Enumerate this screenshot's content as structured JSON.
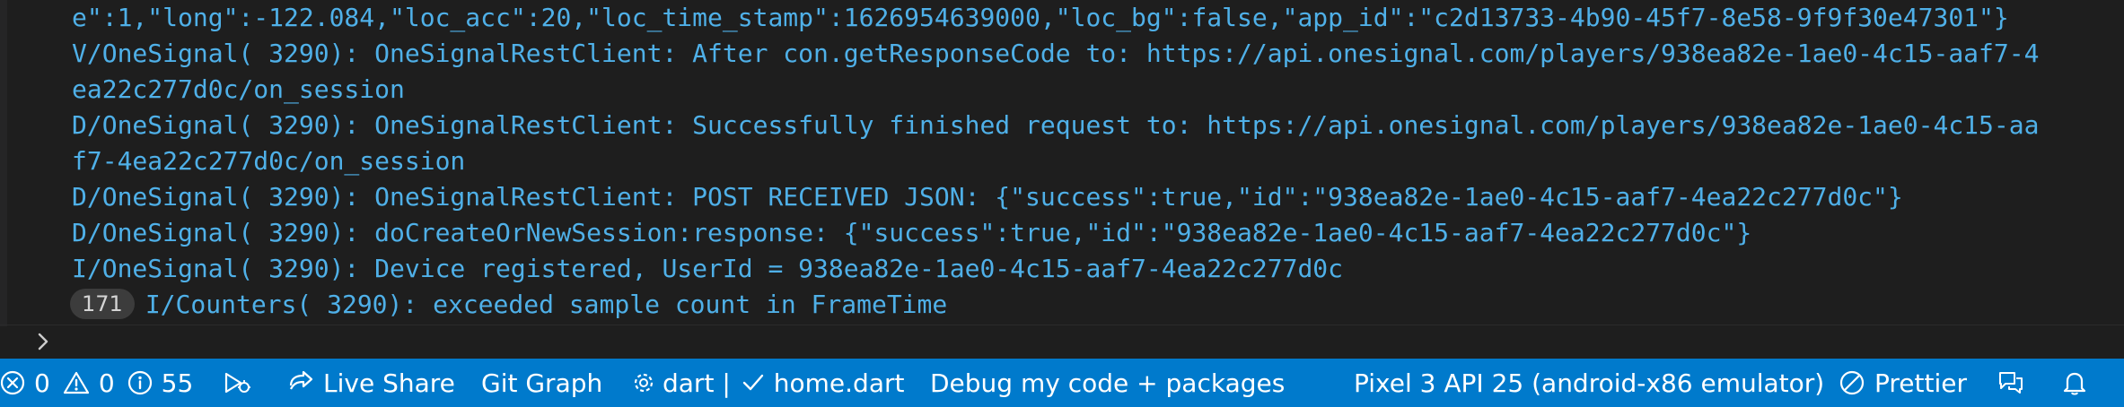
{
  "console": {
    "lines": [
      {
        "text": "e\":1,\"long\":-122.084,\"loc_acc\":20,\"loc_time_stamp\":1626954639000,\"loc_bg\":false,\"app_id\":\"c2d13733-4b90-45f7-8e58-9f9f30e47301\"}"
      },
      {
        "text": "V/OneSignal( 3290): OneSignalRestClient: After con.getResponseCode to: https://api.onesignal.com/players/938ea82e-1ae0-4c15-aaf7-4"
      },
      {
        "text": "ea22c277d0c/on_session"
      },
      {
        "text": "D/OneSignal( 3290): OneSignalRestClient: Successfully finished request to: https://api.onesignal.com/players/938ea82e-1ae0-4c15-aa"
      },
      {
        "text": "f7-4ea22c277d0c/on_session"
      },
      {
        "text": "D/OneSignal( 3290): OneSignalRestClient: POST RECEIVED JSON: {\"success\":true,\"id\":\"938ea82e-1ae0-4c15-aaf7-4ea22c277d0c\"}"
      },
      {
        "text": "D/OneSignal( 3290): doCreateOrNewSession:response: {\"success\":true,\"id\":\"938ea82e-1ae0-4c15-aaf7-4ea22c277d0c\"}"
      },
      {
        "text": "I/OneSignal( 3290): Device registered, UserId = 938ea82e-1ae0-4c15-aaf7-4ea22c277d0c"
      },
      {
        "text": "I/Counters( 3290): exceeded sample count in FrameTime",
        "count": "171"
      }
    ]
  },
  "statusbar": {
    "errors": "0",
    "warnings": "0",
    "infos": "55",
    "live_share": "Live Share",
    "git_graph": "Git Graph",
    "dart": "dart |",
    "dart_file": "home.dart",
    "debug_mode": "Debug my code + packages",
    "device": "Pixel 3 API 25 (android-x86 emulator)",
    "prettier": "Prettier"
  },
  "colors": {
    "console_text": "#4fb0e8",
    "background": "#1e1e1e",
    "statusbar": "#007acc"
  },
  "icons": {
    "prompt": "chevron-right-icon",
    "errors": "error-circle-icon",
    "warnings": "warning-triangle-icon",
    "infos": "info-circle-icon",
    "run": "run-debug-icon",
    "live_share": "live-share-icon",
    "dart": "gear-icon",
    "dart_file": "check-icon",
    "prettier": "prettier-icon",
    "feedback": "feedback-icon",
    "notifications": "bell-icon"
  }
}
